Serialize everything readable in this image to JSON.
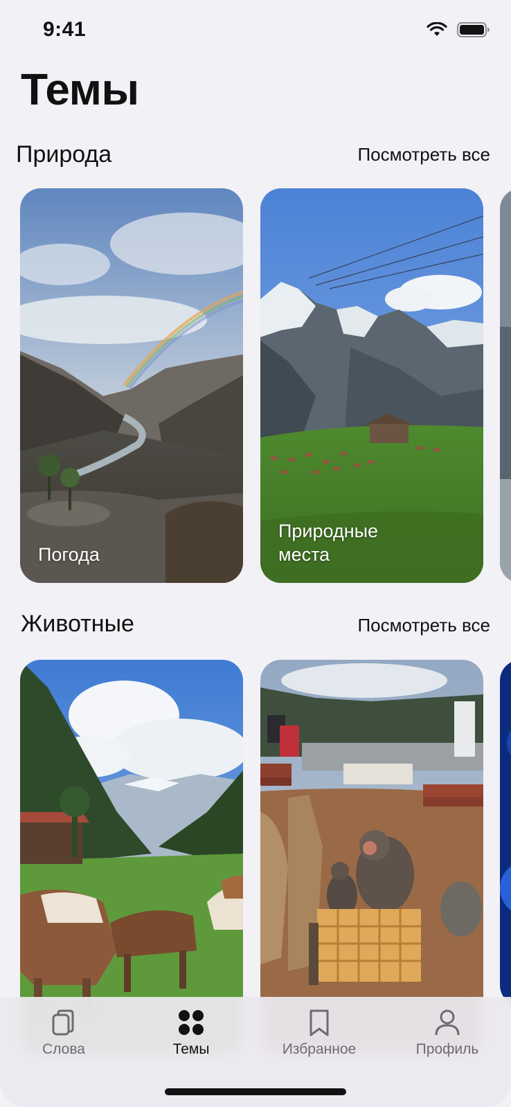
{
  "status_bar": {
    "time": "9:41",
    "icons": [
      "wifi-icon",
      "battery-icon"
    ]
  },
  "page": {
    "title": "Темы"
  },
  "sections": [
    {
      "title": "Природа",
      "see_all": "Посмотреть все",
      "cards": [
        {
          "label": "Погода",
          "image": "rainbow-valley"
        },
        {
          "label": "Природные\nместа",
          "image": "alpine-meadow-cows"
        }
      ]
    },
    {
      "title": "Животные",
      "see_all": "Посмотреть все",
      "cards": [
        {
          "label": "",
          "image": "cows-in-valley"
        },
        {
          "label": "",
          "image": "monkeys-on-crate"
        }
      ]
    }
  ],
  "tabbar": {
    "items": [
      {
        "label": "Слова",
        "icon": "cards-icon",
        "active": false
      },
      {
        "label": "Темы",
        "icon": "grid-dots-icon",
        "active": true
      },
      {
        "label": "Избранное",
        "icon": "bookmark-icon",
        "active": false
      },
      {
        "label": "Профиль",
        "icon": "person-icon",
        "active": false
      }
    ]
  },
  "colors": {
    "background": "#F2F1F6",
    "text": "#111111",
    "tab_inactive": "#6B6B70"
  }
}
